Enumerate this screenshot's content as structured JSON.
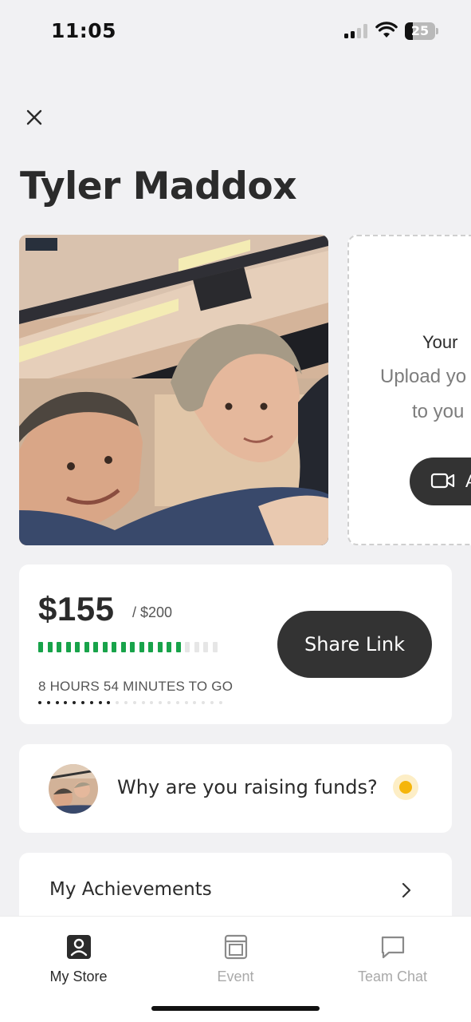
{
  "status_bar": {
    "time": "11:05",
    "battery": "25",
    "battery_level": 0.25
  },
  "header": {
    "close_icon": "close-icon",
    "title": "Tyler Maddox"
  },
  "media": {
    "upload_card": {
      "title": "Your",
      "desc_line1": "Upload yo",
      "desc_line2": "to you",
      "button_icon": "video-camera-icon",
      "button_label": "A"
    }
  },
  "funds": {
    "raised": "$155",
    "goal": "/ $200",
    "progress": 0.775,
    "progress_segments": 20,
    "progress_segments_filled": 16,
    "time_left": "8 HOURS 54 MINUTES TO GO",
    "time_dots": 22,
    "time_dots_filled": 9,
    "share_label": "Share Link",
    "accent_color": "#18a34a"
  },
  "why": {
    "text": "Why are you raising funds?",
    "status_color": "#f5b50a"
  },
  "achievements": {
    "label": "My Achievements",
    "chevron_icon": "chevron-right-icon"
  },
  "tabs": [
    {
      "label": "My Store",
      "icon": "store-profile-icon",
      "active": true
    },
    {
      "label": "Event",
      "icon": "event-window-icon",
      "active": false
    },
    {
      "label": "Team Chat",
      "icon": "chat-bubble-icon",
      "active": false
    }
  ]
}
